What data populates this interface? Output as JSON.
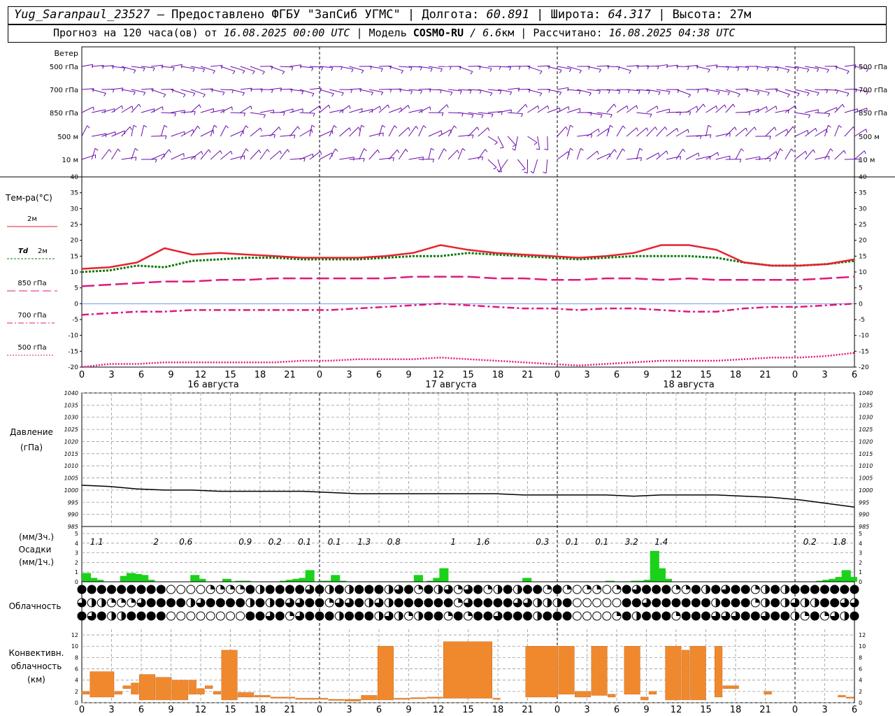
{
  "header": {
    "station": "Yug_Saranpaul_23527",
    "provider": " — Предоставлено ФГБУ \"ЗапСиб УГМС\" | Долгота: ",
    "lon": "60.891",
    "lat_label": " | Широта: ",
    "lat": "64.317",
    "alt_label": " | Высота: 27м",
    "forecast_label": "Прогноз на 120 часа(ов) от ",
    "forecast_from": "16.08.2025 00:00 UTC",
    "model_label": "  | Модель ",
    "model": "COSMO-RU",
    "resolution": " / 6.6",
    "res_unit": "км",
    "calc_label": " | Рассчитано: ",
    "calc_time": "16.08.2025 04:38 UTC"
  },
  "labels": {
    "wind": "Ветер",
    "levels": [
      "500 гПа",
      "700 гПа",
      "850 гПа",
      "500 м",
      "10  м"
    ],
    "temp": "Тем-ра(°C)",
    "t2m": "2м",
    "td": "Td",
    "td2m": "2м",
    "t850": "850 гПа",
    "t700": "700 гПа",
    "t500": "500 гПа",
    "pressure": "Давление",
    "pressure_unit": "(гПа)",
    "precip_unit3": "(мм/3ч.)",
    "precip": "Осадки",
    "precip_unit1": "(мм/1ч.)",
    "cloud": "Облачность",
    "conv1": "Конвективн.",
    "conv2": "облачность",
    "conv3": "(км)",
    "dates": [
      "16 августа",
      "17 августа",
      "18 августа"
    ]
  },
  "colors": {
    "wind": "#6a0dad",
    "t2m": "#e8222e",
    "td": "#0a7a0a",
    "t850": "#e0197d",
    "precip": "#19d219",
    "conv": "#f0892e"
  },
  "chart_data": {
    "type": "line",
    "hours": [
      "0",
      "3",
      "6",
      "9",
      "12",
      "15",
      "18",
      "21",
      "0",
      "3",
      "6",
      "9",
      "12",
      "15",
      "18",
      "21",
      "0",
      "3",
      "6",
      "9",
      "12",
      "15",
      "18",
      "21",
      "0",
      "3",
      "6"
    ],
    "temperature": {
      "ylim": [
        -20,
        40
      ],
      "ticks": [
        40,
        35,
        30,
        25,
        20,
        15,
        10,
        5,
        0,
        -5,
        -10,
        -15,
        -20
      ],
      "t2m": [
        11,
        11.5,
        13,
        17.5,
        15.5,
        16,
        15.5,
        15,
        14.5,
        14.5,
        14.5,
        15,
        16,
        18.5,
        17,
        16,
        15.5,
        15,
        14.5,
        15,
        16,
        18.5,
        18.5,
        17,
        13,
        12,
        12,
        12.5,
        14
      ],
      "td": [
        10,
        10.5,
        12,
        11.5,
        13.5,
        14,
        14.5,
        14.5,
        14,
        14,
        14,
        14.5,
        15,
        15,
        16,
        15.5,
        15,
        14.5,
        14,
        14.5,
        15,
        15,
        15,
        14.5,
        13,
        12,
        12,
        12.5,
        13.5
      ],
      "t850": [
        5.5,
        6,
        6.5,
        7,
        7,
        7.5,
        7.5,
        8,
        8,
        8,
        8,
        8,
        8.5,
        8.5,
        8.5,
        8,
        8,
        7.5,
        7.5,
        8,
        8,
        7.5,
        8,
        7.5,
        7.5,
        7.5,
        7.5,
        8,
        8.5
      ],
      "t700": [
        -3.5,
        -3,
        -2.5,
        -2.5,
        -2,
        -2,
        -2,
        -2,
        -2,
        -2,
        -1.5,
        -1,
        -0.5,
        0,
        -0.5,
        -1,
        -1.5,
        -1.5,
        -2,
        -1.5,
        -1.5,
        -2,
        -2.5,
        -2.5,
        -1.5,
        -1,
        -1,
        -0.5,
        0
      ],
      "t500": [
        -20,
        -19,
        -19,
        -18.5,
        -18.5,
        -18.5,
        -18.5,
        -18.5,
        -18,
        -18,
        -17.5,
        -17.5,
        -17.5,
        -17,
        -17.5,
        -18,
        -18.5,
        -19,
        -19.5,
        -19,
        -18.5,
        -18,
        -18,
        -18,
        -17.5,
        -17,
        -17,
        -16.5,
        -15.5
      ]
    },
    "pressure": {
      "ylim": [
        985,
        1040
      ],
      "ticks": [
        1040,
        1035,
        1030,
        1025,
        1020,
        1015,
        1010,
        1005,
        1000,
        995,
        990,
        985
      ],
      "values": [
        1002,
        1001.5,
        1000.5,
        1000,
        1000,
        999.5,
        999.5,
        999.5,
        999.5,
        999,
        998.5,
        998.5,
        998.5,
        998.5,
        998.5,
        998.5,
        998,
        998,
        998,
        998,
        997.5,
        998,
        998,
        998,
        997.5,
        997,
        996,
        994.5,
        993
      ]
    },
    "precip": {
      "ylim": [
        0,
        5
      ],
      "ticks": [
        5,
        4,
        3,
        2,
        1,
        0
      ],
      "totals3h": [
        {
          "h": 1.5,
          "v": "1.1"
        },
        {
          "h": 7.5,
          "v": "2"
        },
        {
          "h": 10.5,
          "v": "0.6"
        },
        {
          "h": 16.5,
          "v": "0.9"
        },
        {
          "h": 19.5,
          "v": "0.2"
        },
        {
          "h": 22.5,
          "v": "0.1"
        },
        {
          "h": 25.5,
          "v": "0.1"
        },
        {
          "h": 28.5,
          "v": "1.3"
        },
        {
          "h": 31.5,
          "v": "0.8"
        },
        {
          "h": 37.5,
          "v": "1"
        },
        {
          "h": 40.5,
          "v": "1.6"
        },
        {
          "h": 46.5,
          "v": "0.3"
        },
        {
          "h": 49.5,
          "v": "0.1"
        },
        {
          "h": 52.5,
          "v": "0.1"
        },
        {
          "h": 55.5,
          "v": "3.2"
        },
        {
          "h": 58.5,
          "v": "1.4"
        },
        {
          "h": 73.5,
          "v": "0.2"
        },
        {
          "h": 76.5,
          "v": "1.8"
        }
      ],
      "hourly": [
        0.9,
        0.4,
        0.2,
        0,
        0,
        0,
        0.6,
        0.9,
        0.8,
        0.7,
        0.2,
        0,
        0,
        0,
        0,
        0,
        0,
        0.7,
        0.3,
        0,
        0,
        0,
        0.3,
        0,
        0.1,
        0.1,
        0,
        0,
        0,
        0,
        0,
        0.1,
        0.2,
        0.3,
        0.4,
        1.2,
        0,
        0.1,
        0.1,
        0.7,
        0.1,
        0,
        0,
        0,
        0,
        0,
        0,
        0,
        0,
        0,
        0,
        0,
        0.7,
        0,
        0.1,
        0.4,
        1.4,
        0,
        0,
        0,
        0,
        0,
        0,
        0,
        0,
        0,
        0,
        0,
        0,
        0.4,
        0,
        0,
        0,
        0,
        0,
        0,
        0,
        0,
        0,
        0,
        0,
        0,
        0.1,
        0,
        0,
        0,
        0.1,
        0.1,
        0.2,
        3.2,
        1.4,
        0.3,
        0,
        0,
        0,
        0,
        0,
        0,
        0,
        0,
        0,
        0,
        0,
        0,
        0,
        0,
        0,
        0,
        0,
        0,
        0,
        0,
        0,
        0,
        0,
        0.1,
        0.2,
        0.3,
        0.5,
        1.2,
        0.5
      ]
    },
    "convective": {
      "ylim": [
        0,
        13
      ],
      "ticks": [
        12,
        10,
        8,
        6,
        4,
        2,
        0
      ],
      "bars": [
        {
          "s": 0,
          "e": 1,
          "lo": 1.5,
          "hi": 2
        },
        {
          "s": 1,
          "e": 4,
          "lo": 1,
          "hi": 5.5
        },
        {
          "s": 4,
          "e": 5,
          "lo": 1.5,
          "hi": 2
        },
        {
          "s": 5,
          "e": 6,
          "lo": 2.5,
          "hi": 3
        },
        {
          "s": 6,
          "e": 7,
          "lo": 1.5,
          "hi": 3.5
        },
        {
          "s": 7,
          "e": 9,
          "lo": 0.5,
          "hi": 5
        },
        {
          "s": 9,
          "e": 11,
          "lo": 0.5,
          "hi": 4.5
        },
        {
          "s": 11,
          "e": 13,
          "lo": 0.5,
          "hi": 4
        },
        {
          "s": 13,
          "e": 14,
          "lo": 1.5,
          "hi": 4
        },
        {
          "s": 14,
          "e": 15,
          "lo": 1.5,
          "hi": 2.5
        },
        {
          "s": 15,
          "e": 16,
          "lo": 2.5,
          "hi": 3
        },
        {
          "s": 16,
          "e": 17,
          "lo": 1.5,
          "hi": 2
        },
        {
          "s": 17,
          "e": 19,
          "lo": 0.5,
          "hi": 9.3
        },
        {
          "s": 19,
          "e": 21,
          "lo": 1,
          "hi": 1.8
        },
        {
          "s": 21,
          "e": 23,
          "lo": 1,
          "hi": 1.3
        },
        {
          "s": 23,
          "e": 26,
          "lo": 0.8,
          "hi": 1
        },
        {
          "s": 26,
          "e": 30,
          "lo": 0.6,
          "hi": 0.8
        },
        {
          "s": 30,
          "e": 32,
          "lo": 0.5,
          "hi": 0.6
        },
        {
          "s": 32,
          "e": 34,
          "lo": 0.3,
          "hi": 0.6
        },
        {
          "s": 34,
          "e": 36,
          "lo": 0.5,
          "hi": 1.3
        },
        {
          "s": 36,
          "e": 38,
          "lo": 0.5,
          "hi": 10
        },
        {
          "s": 38,
          "e": 40,
          "lo": 0.6,
          "hi": 0.8
        },
        {
          "s": 40,
          "e": 42,
          "lo": 0.7,
          "hi": 0.9
        },
        {
          "s": 42,
          "e": 44,
          "lo": 0.8,
          "hi": 1
        },
        {
          "s": 44,
          "e": 50,
          "lo": 0.8,
          "hi": 10.8
        },
        {
          "s": 50,
          "e": 51,
          "lo": 0.6,
          "hi": 0.8
        },
        {
          "s": 54,
          "e": 58,
          "lo": 1,
          "hi": 10
        },
        {
          "s": 58,
          "e": 60,
          "lo": 1.5,
          "hi": 10
        },
        {
          "s": 60,
          "e": 62,
          "lo": 1,
          "hi": 2
        },
        {
          "s": 62,
          "e": 64,
          "lo": 1.3,
          "hi": 10
        },
        {
          "s": 64,
          "e": 65,
          "lo": 1,
          "hi": 1.5
        },
        {
          "s": 66,
          "e": 68,
          "lo": 1.5,
          "hi": 10
        },
        {
          "s": 68,
          "e": 69,
          "lo": 0.5,
          "hi": 1
        },
        {
          "s": 69,
          "e": 70,
          "lo": 1.5,
          "hi": 2
        },
        {
          "s": 71,
          "e": 73,
          "lo": 0.5,
          "hi": 10
        },
        {
          "s": 73,
          "e": 74,
          "lo": 0.5,
          "hi": 9.3
        },
        {
          "s": 74,
          "e": 76,
          "lo": 0.5,
          "hi": 10
        },
        {
          "s": 77,
          "e": 78,
          "lo": 1,
          "hi": 10
        },
        {
          "s": 78,
          "e": 80,
          "lo": 2.5,
          "hi": 3
        },
        {
          "s": 83,
          "e": 84,
          "lo": 1.5,
          "hi": 2
        },
        {
          "s": 92,
          "e": 93,
          "lo": 1,
          "hi": 1.3
        },
        {
          "s": 93,
          "e": 94,
          "lo": 0.8,
          "hi": 1
        }
      ]
    }
  }
}
